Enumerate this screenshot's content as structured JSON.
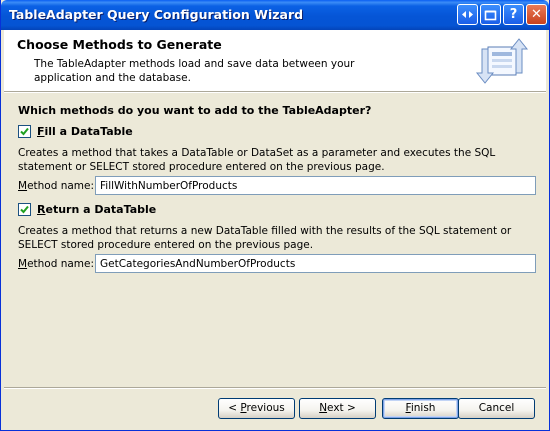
{
  "window": {
    "title": "TableAdapter Query Configuration Wizard",
    "caption_buttons": [
      "help-overlay-icon",
      "restore-icon",
      "help-icon",
      "close-icon"
    ]
  },
  "header": {
    "title": "Choose Methods to Generate",
    "description": "The TableAdapter methods load and save data between your application and the database."
  },
  "body": {
    "question": "Which methods do you want to add to the TableAdapter?",
    "fill": {
      "checked": true,
      "label_prefix": "F",
      "label_rest": "ill a DataTable",
      "description": "Creates a method that takes a DataTable or DataSet as a parameter and executes the SQL statement or SELECT stored procedure entered on the previous page.",
      "method_label_prefix": "M",
      "method_label_rest": "ethod name:",
      "method_value": "FillWithNumberOfProducts"
    },
    "return": {
      "checked": true,
      "label_prefix": "R",
      "label_rest": "eturn a DataTable",
      "description": "Creates a method that returns a new DataTable filled with the results of the SQL statement or SELECT stored procedure entered on the previous page.",
      "method_label_prefix": "M",
      "method_label_rest": "ethod name:",
      "method_value": "GetCategoriesAndNumberOfProducts"
    }
  },
  "footer": {
    "previous": {
      "pre": "< ",
      "key": "P",
      "rest": "revious"
    },
    "next": {
      "key": "N",
      "rest": "ext >"
    },
    "finish": {
      "key": "F",
      "rest": "inish"
    },
    "cancel": "Cancel"
  },
  "colors": {
    "titlebar": "#0555d6",
    "dialog_bg": "#ece9d8",
    "check_green": "#21a121"
  }
}
